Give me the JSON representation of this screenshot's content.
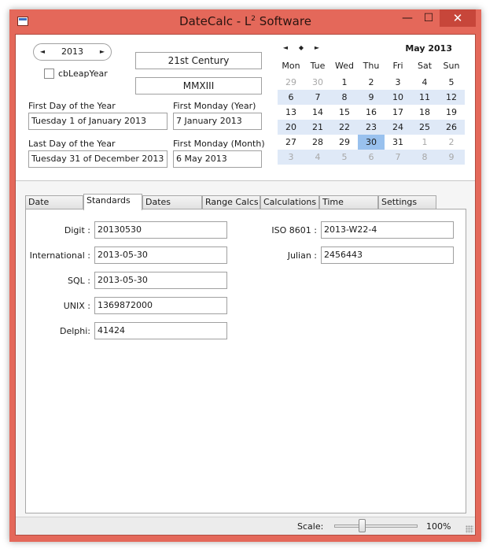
{
  "window": {
    "title_main": "DateCalc - L",
    "title_sup": "2",
    "title_rest": " Software",
    "min_glyph": "—",
    "max_glyph": "☐",
    "close_glyph": "✕"
  },
  "top": {
    "year_left_icon": "◄",
    "year_value": "2013",
    "year_right_icon": "►",
    "leap_label": "cbLeapYear",
    "century": "21st Century",
    "roman": "MMXIII",
    "first_day_label": "First Day of the Year",
    "first_day_value": "Tuesday 1 of January 2013",
    "first_monday_year_label": "First Monday (Year)",
    "first_monday_year_value": "7 January 2013",
    "last_day_label": "Last Day of the Year",
    "last_day_value": "Tuesday 31 of December 2013",
    "first_monday_month_label": "First Monday (Month)",
    "first_monday_month_value": "6 May 2013"
  },
  "calendar": {
    "nav_prev": "◄",
    "nav_today": "◆",
    "nav_next": "►",
    "month_title": "May  2013",
    "weekdays": [
      "Mon",
      "Tue",
      "Wed",
      "Thu",
      "Fri",
      "Sat",
      "Sun"
    ],
    "weeks": [
      [
        "29",
        "30",
        "1",
        "2",
        "3",
        "4",
        "5"
      ],
      [
        "6",
        "7",
        "8",
        "9",
        "10",
        "11",
        "12"
      ],
      [
        "13",
        "14",
        "15",
        "16",
        "17",
        "18",
        "19"
      ],
      [
        "20",
        "21",
        "22",
        "23",
        "24",
        "25",
        "26"
      ],
      [
        "27",
        "28",
        "29",
        "30",
        "31",
        "1",
        "2"
      ],
      [
        "3",
        "4",
        "5",
        "6",
        "7",
        "8",
        "9"
      ]
    ],
    "selected_day": "30",
    "selection_color": "#99c1ee",
    "row_shade_color": "#dfe9f7"
  },
  "tabs": [
    {
      "label": "Date"
    },
    {
      "label": "Standards"
    },
    {
      "label": "Dates"
    },
    {
      "label": "Range Calcs"
    },
    {
      "label": "Calculations"
    },
    {
      "label": "Time"
    },
    {
      "label": "Settings"
    }
  ],
  "active_tab": "Standards",
  "standards": {
    "digit_label": "Digit :",
    "digit_value": "20130530",
    "international_label": "International :",
    "international_value": "2013-05-30",
    "sql_label": "SQL :",
    "sql_value": "2013-05-30",
    "unix_label": "UNIX :",
    "unix_value": "1369872000",
    "delphi_label": "Delphi:",
    "delphi_value": "41424",
    "iso_label": "ISO 8601 :",
    "iso_value": "2013-W22-4",
    "julian_label": "Julian :",
    "julian_value": "2456443"
  },
  "statusbar": {
    "scale_label": "Scale:",
    "scale_value": "100%"
  },
  "colors": {
    "window_frame": "#e4685a",
    "close_button": "#c7463a"
  }
}
